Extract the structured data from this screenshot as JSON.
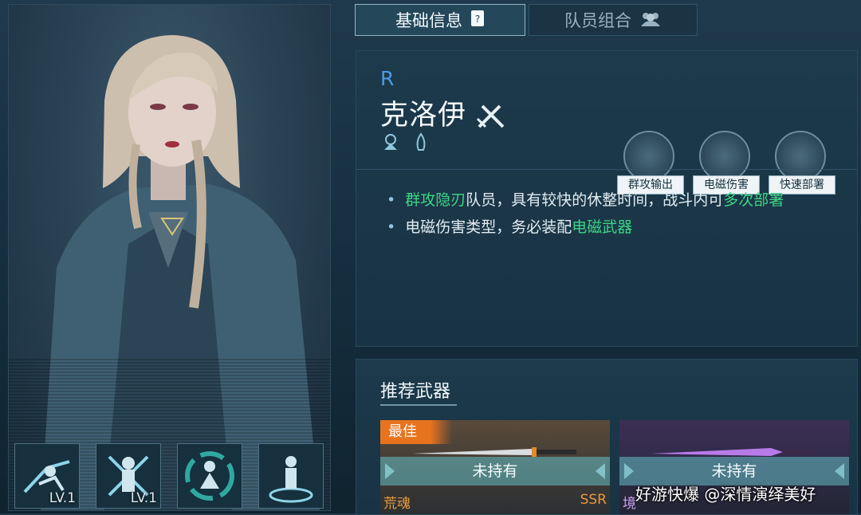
{
  "tabs": [
    {
      "label": "基础信息",
      "icon": "document-icon",
      "active": true
    },
    {
      "label": "队员组合",
      "icon": "team-icon",
      "active": false
    }
  ],
  "character": {
    "rarity": "R",
    "name": "克洛伊",
    "class_icon": "crossed-blades-icon",
    "sub_icons": [
      "beacon-icon",
      "flame-icon"
    ],
    "tags": [
      "群攻输出",
      "电磁伤害",
      "快速部署"
    ]
  },
  "description": [
    [
      {
        "t": "群攻隐刃",
        "hl": true
      },
      {
        "t": "队员，具有较快的休整时间，战斗内可",
        "hl": false
      },
      {
        "t": "多次部署",
        "hl": true
      }
    ],
    [
      {
        "t": "电磁伤害类型，务必装配",
        "hl": false
      },
      {
        "t": "电磁武器",
        "hl": true
      }
    ]
  ],
  "skills": [
    {
      "icon": "dash-slash-icon",
      "level": "LV.1"
    },
    {
      "icon": "crossed-swords-soldier-icon",
      "level": "LV.1"
    },
    {
      "icon": "cycle-figure-icon",
      "level": ""
    },
    {
      "icon": "summon-circle-icon",
      "level": ""
    }
  ],
  "weapons": {
    "title": "推荐武器",
    "items": [
      {
        "badge": "最佳",
        "status": "未持有",
        "name": "荒魂",
        "grade": "SSR"
      },
      {
        "badge": "",
        "status": "未持有",
        "name": "境",
        "grade": ""
      }
    ]
  },
  "watermark": "好游快爆 @深情演绎美好",
  "colors": {
    "highlight": "#3ed584",
    "rarity": "#4a9be8",
    "best_badge": "#e8731f"
  }
}
